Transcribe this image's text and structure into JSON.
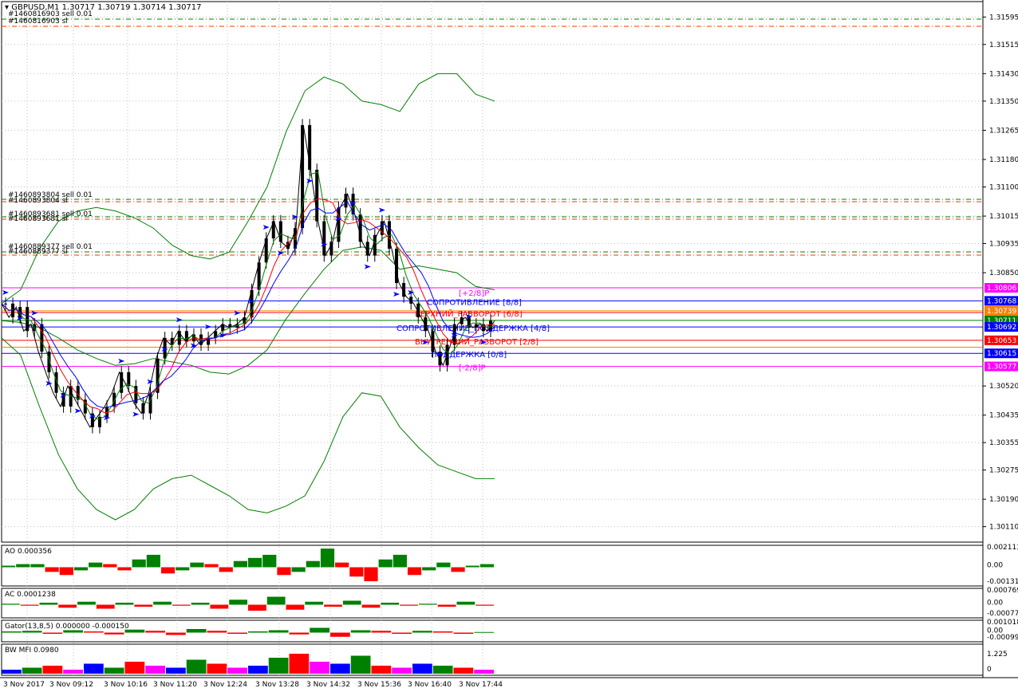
{
  "window": {
    "title": "GBPUSD,M1  1.30717 1.30719 1.30714 1.30717"
  },
  "trade_labels": [
    "#1460816903 sell 0.01",
    "#1460816903 sl",
    "#1460893804 sell 0.01",
    "#1460893804 sl",
    "#1460893681 sell 0.01",
    "#1460893681 sl",
    "#1460889377 sell 0.01",
    "#1460889377 sl"
  ],
  "colors": {
    "grid": "#c0c0c0",
    "bollinger": "#008000",
    "candles": "#000000",
    "fractal_arrows": "#0000ff",
    "ao_up": "#008000",
    "ao_down": "#ff0000",
    "murrey_plus2": "#ff00ff",
    "murrey_8": "#0000ff",
    "murrey_6": "#ff0000",
    "murrey_4": "#0000ff",
    "murrey_2": "#ff0000",
    "murrey_0": "#0000ff"
  },
  "chart_data": [
    {
      "type": "candlestick",
      "title": "GBPUSD,M1",
      "ohlc_last": {
        "open": 1.30717,
        "high": 1.30719,
        "low": 1.30714,
        "close": 1.30717
      },
      "ylim": [
        1.30065,
        1.3164
      ],
      "y_ticks": [
        "1.31595",
        "1.31515",
        "1.31430",
        "1.31350",
        "1.31265",
        "1.31180",
        "1.31100",
        "1.31015",
        "1.30935",
        "1.30850",
        "1.30520",
        "1.30435",
        "1.30355",
        "1.30275",
        "1.30190",
        "1.30110"
      ],
      "x_ticks": [
        "3 Nov 2017",
        "3 Nov 09:12",
        "3 Nov 10:16",
        "3 Nov 11:20",
        "3 Nov 12:24",
        "3 Nov 13:28",
        "3 Nov 14:32",
        "3 Nov 15:36",
        "3 Nov 16:40",
        "3 Nov 17:44"
      ],
      "price_series": [
        1.3076,
        1.3072,
        1.3075,
        1.3068,
        1.307,
        1.3062,
        1.3056,
        1.305,
        1.3046,
        1.3052,
        1.3048,
        1.3044,
        1.304,
        1.3043,
        1.3046,
        1.305,
        1.3056,
        1.3052,
        1.3047,
        1.3044,
        1.305,
        1.306,
        1.3066,
        1.3064,
        1.3068,
        1.3065,
        1.3067,
        1.3064,
        1.3066,
        1.3068,
        1.307,
        1.3069,
        1.307,
        1.3072,
        1.308,
        1.3088,
        1.3095,
        1.31,
        1.3094,
        1.3092,
        1.3098,
        1.3128,
        1.3115,
        1.31,
        1.309,
        1.3094,
        1.3104,
        1.3108,
        1.3102,
        1.3094,
        1.309,
        1.3096,
        1.31,
        1.3092,
        1.3082,
        1.3078,
        1.3076,
        1.3072,
        1.3068,
        1.3062,
        1.3058,
        1.3064,
        1.307,
        1.3072,
        1.3069,
        1.307,
        1.3068,
        1.3071
      ],
      "bollinger_upper": [
        1.3076,
        1.308,
        1.3092,
        1.31,
        1.3103,
        1.3104,
        1.3103,
        1.3101,
        1.3098,
        1.3093,
        1.309,
        1.3089,
        1.3091,
        1.31,
        1.311,
        1.3126,
        1.3138,
        1.3142,
        1.314,
        1.3135,
        1.3134,
        1.3132,
        1.314,
        1.3143,
        1.3143,
        1.3137,
        1.3135
      ],
      "bollinger_lower": [
        1.3066,
        1.3061,
        1.3046,
        1.3032,
        1.3022,
        1.3016,
        1.3013,
        1.3016,
        1.3022,
        1.3025,
        1.3026,
        1.3023,
        1.302,
        1.3016,
        1.3015,
        1.3017,
        1.302,
        1.303,
        1.3043,
        1.305,
        1.3049,
        1.304,
        1.3034,
        1.3029,
        1.3027,
        1.3025,
        1.3025
      ],
      "murrey_levels": [
        {
          "label": "[+2/8]P",
          "value": 1.30806
        },
        {
          "label": "СОПРОТИВЛЕНИЕ [8/8]",
          "value": 1.30768
        },
        {
          "label": "ВЕРХНИЙ_РАЗВОРОТ [6/8]",
          "value": 1.30734
        },
        {
          "label": "СОПРОТИВЛЕНИЕ_ПОДДЕРЖКА [4/8]",
          "value": 1.30692
        },
        {
          "label": "ВНУТРЕННИЙ_РАЗВОРОТ [2/8]",
          "value": 1.30653
        },
        {
          "label": "ПОДДЕРЖКА [0/8]",
          "value": 1.30615
        },
        {
          "label": "[-2/8]P",
          "value": 1.30577
        }
      ],
      "price_tags": [
        "1.30806",
        "1.30768",
        "1.30739",
        "1.30711",
        "1.30692",
        "1.30653",
        "1.30615",
        "1.30577"
      ]
    },
    {
      "type": "bar",
      "name": "AO 0.000356",
      "y_ticks": [
        "0.002113",
        "0.00",
        "-0.001312"
      ],
      "values": [
        0.1,
        0.2,
        0.2,
        -0.3,
        -0.5,
        -0.2,
        0.3,
        0.2,
        -0.2,
        0.5,
        0.8,
        -0.4,
        -0.2,
        0.3,
        0.2,
        -0.3,
        0.4,
        0.6,
        0.8,
        -0.5,
        -0.3,
        0.4,
        1.2,
        0.3,
        -0.6,
        -0.9,
        0.5,
        0.8,
        -0.5,
        -0.2,
        0.3,
        -0.3,
        0.1,
        0.2
      ]
    },
    {
      "type": "bar",
      "name": "AC 0.0001238",
      "y_ticks": [
        "0.000769",
        "0.00",
        "-0.000776"
      ],
      "values": [
        0.1,
        -0.1,
        0.2,
        -0.3,
        0.3,
        -0.4,
        0.2,
        -0.2,
        0.3,
        -0.1,
        0.2,
        -0.4,
        0.5,
        -0.6,
        0.8,
        -0.5,
        0.3,
        -0.2,
        0.4,
        -0.3,
        0.2,
        -0.1,
        0.1,
        -0.2,
        0.3,
        -0.1
      ]
    },
    {
      "type": "bar",
      "name": "Gator(13,8,5) 0.000000 -0.000150",
      "y_ticks": [
        "0.001018",
        "0.00",
        "-0.000994"
      ],
      "values": [
        0.2,
        0.3,
        -0.2,
        0.4,
        0.2,
        -0.3,
        0.5,
        0.3,
        -0.4,
        0.6,
        0.3,
        -0.2,
        0.2,
        0.4,
        -0.3,
        0.8,
        -0.7,
        0.4,
        0.3,
        -0.2,
        0.3,
        0.2,
        -0.2,
        0.1
      ]
    },
    {
      "type": "bar",
      "name": "BW MFI 0.0980",
      "y_ticks": [
        "1.225",
        "0"
      ],
      "values": [
        0.2,
        0.3,
        0.4,
        0.2,
        0.5,
        0.3,
        0.6,
        0.4,
        0.3,
        0.7,
        0.5,
        0.3,
        0.4,
        0.8,
        1.0,
        0.6,
        0.5,
        0.9,
        0.4,
        0.3,
        0.5,
        0.4,
        0.3,
        0.2
      ]
    }
  ]
}
